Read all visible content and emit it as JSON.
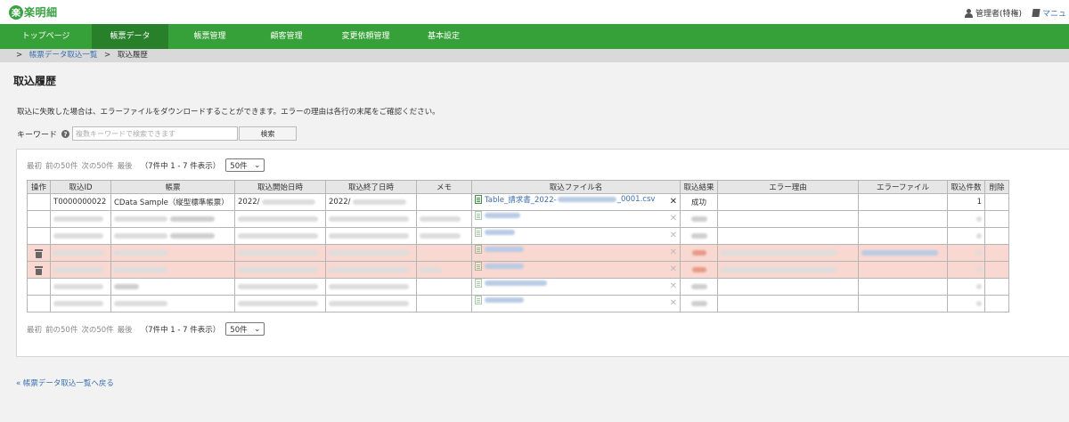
{
  "app": {
    "logo_mark": "楽",
    "logo_text": "楽明細"
  },
  "header": {
    "user": "管理者(特権)",
    "manual": "マニュ"
  },
  "nav": [
    {
      "label": "トップページ",
      "width": 103
    },
    {
      "label": "帳票データ",
      "width": 86
    },
    {
      "label": "帳票管理",
      "width": 93
    },
    {
      "label": "顧客管理",
      "width": 79
    },
    {
      "label": "変更依頼管理",
      "width": 99
    },
    {
      "label": "基本設定",
      "width": 76
    }
  ],
  "nav_active": "帳票データ",
  "breadcrumb": {
    "sep": ">",
    "link": "帳票データ取込一覧",
    "current": "取込履歴"
  },
  "page": {
    "title": "取込履歴",
    "notice": "取込に失敗した場合は、エラーファイルをダウンロードすることができます。エラーの理由は各行の末尾をご確認ください。"
  },
  "search": {
    "label": "キーワード",
    "help_icon": "?",
    "placeholder": "複数キーワードで検索できます",
    "button": "検索"
  },
  "pager": {
    "first": "最初",
    "prev": "前の50件",
    "next": "次の50件",
    "last": "最後",
    "count": "（7件中 1 - 7 件表示）",
    "page_size": "50件"
  },
  "table": {
    "columns": [
      "操作",
      "取込ID",
      "帳票",
      "取込開始日時",
      "取込終了日時",
      "メモ",
      "取込ファイル名",
      "取込結果",
      "エラー理由",
      "エラーファイル",
      "取込件数",
      "削除"
    ],
    "first_row": {
      "id": "T0000000022",
      "form": "CData Sample（縦型標準帳票）",
      "start": "2022/",
      "end": "2022/",
      "file_prefix": "Table_請求書_2022-",
      "file_suffix": "_0001.csv",
      "result": "成功",
      "count": "1"
    }
  },
  "back_link": "« 帳票データ取込一覧へ戻る"
}
